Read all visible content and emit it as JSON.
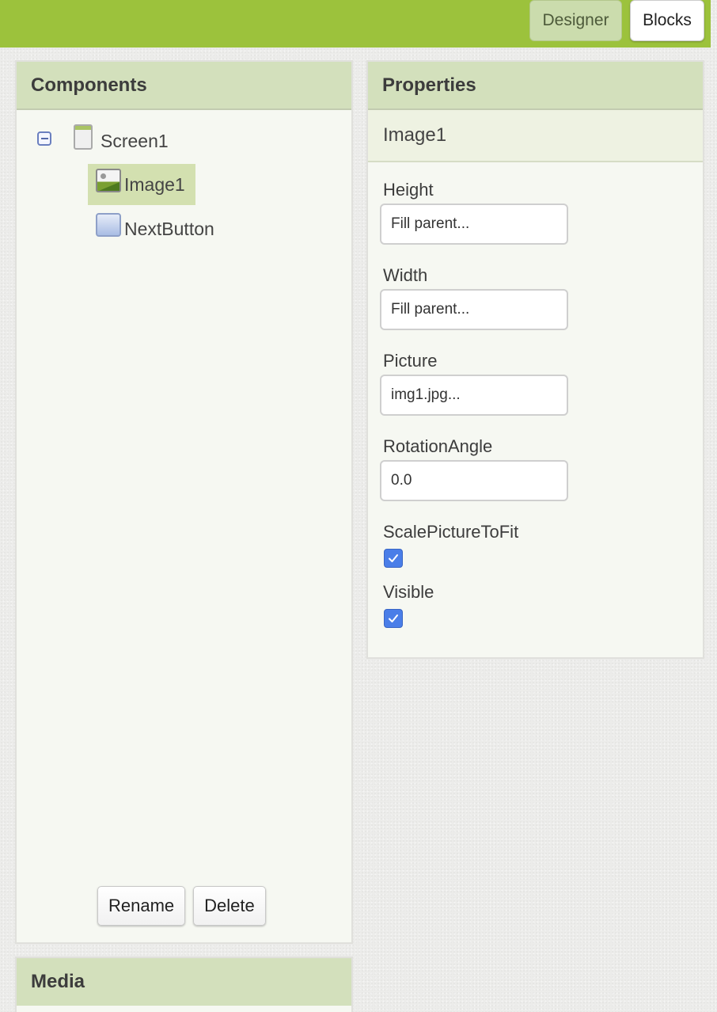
{
  "topbar": {
    "designer_label": "Designer",
    "blocks_label": "Blocks"
  },
  "components_panel": {
    "title": "Components",
    "tree": {
      "screen": "Screen1",
      "children": [
        "Image1",
        "NextButton"
      ],
      "selected": "Image1"
    },
    "rename_label": "Rename",
    "delete_label": "Delete"
  },
  "properties_panel": {
    "title": "Properties",
    "selected_component": "Image1",
    "height": {
      "label": "Height",
      "value": "Fill parent..."
    },
    "width": {
      "label": "Width",
      "value": "Fill parent..."
    },
    "picture": {
      "label": "Picture",
      "value": "img1.jpg..."
    },
    "rotation": {
      "label": "RotationAngle",
      "value": "0.0"
    },
    "scale_to_fit": {
      "label": "ScalePictureToFit",
      "checked": true
    },
    "visible": {
      "label": "Visible",
      "checked": true
    }
  },
  "media_panel": {
    "title": "Media"
  },
  "colors": {
    "topbar": "#9cc23c",
    "panel_header": "#d3e0bc",
    "selection": "#d3e0b0",
    "checkbox": "#4a7ee8"
  },
  "icons": [
    "collapse-icon",
    "screen-icon",
    "image-icon",
    "button-icon",
    "checkmark-icon"
  ]
}
